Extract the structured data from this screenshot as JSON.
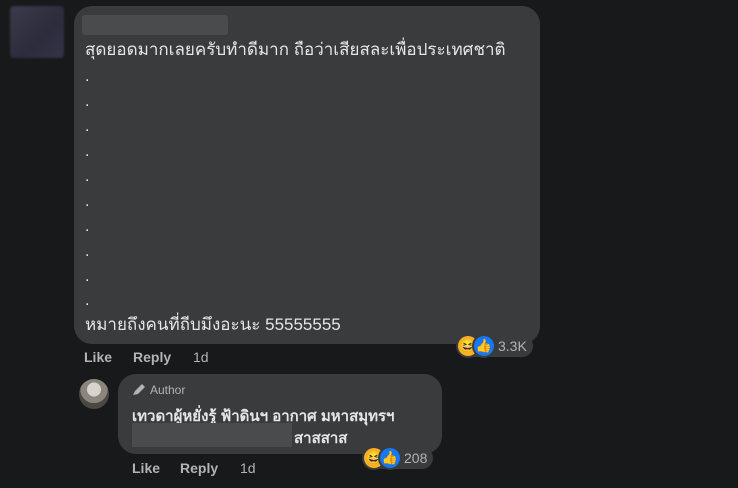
{
  "comment": {
    "text_line_1": "สุดยอดมากเลยครับทำดีมาก ถือว่าเสียสละเพื่อประเทศชาติ",
    "dots": [
      ".",
      ".",
      ".",
      ".",
      ".",
      ".",
      ".",
      ".",
      ".",
      "."
    ],
    "text_line_last": "หมายถึงคนที่ถีบมึงอะนะ 55555555",
    "actions": {
      "like": "Like",
      "reply": "Reply",
      "time": "1d"
    },
    "reactions": {
      "count": "3.3K",
      "icons": [
        "laugh-emoji",
        "like-thumb"
      ]
    }
  },
  "reply": {
    "badge": "Author",
    "line_1": "เทวดาผู้หยั่งรู้ ฟ้าดินฯ อากาศ มหาสมุทรฯ",
    "line_2": "สาสสาส",
    "actions": {
      "like": "Like",
      "reply": "Reply",
      "time": "1d"
    },
    "reactions": {
      "count": "208",
      "icons": [
        "laugh-emoji",
        "like-thumb"
      ]
    }
  },
  "colors": {
    "background": "#18191a",
    "bubble": "#3a3b3c",
    "text": "#e4e6eb",
    "muted": "#b0b3b8",
    "like_blue": "#1877f2",
    "laugh_yellow": "#f7b125"
  }
}
